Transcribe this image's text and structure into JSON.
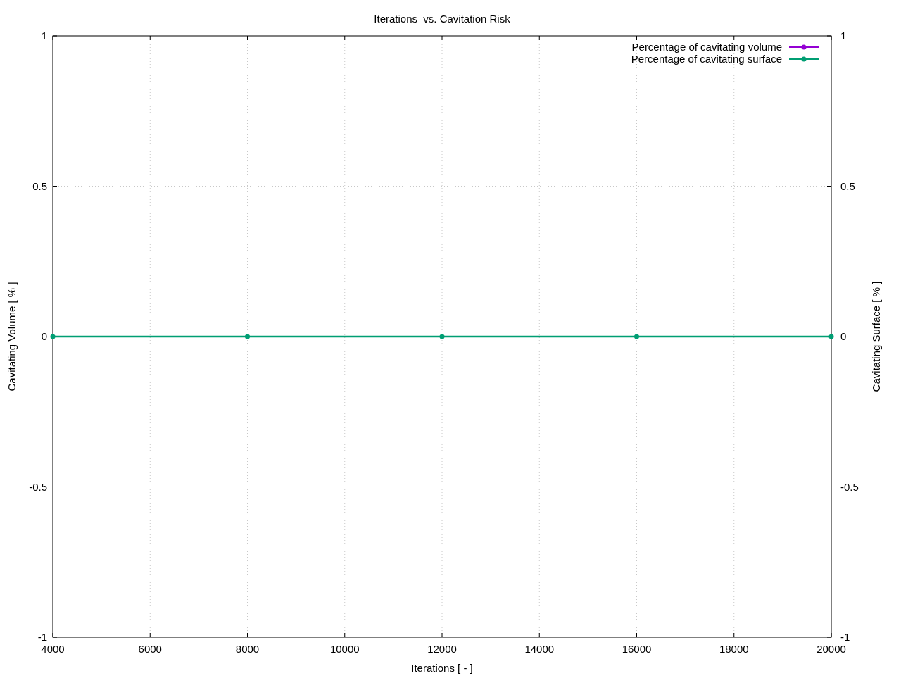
{
  "chart": {
    "chart_data": {
      "type": "line",
      "title": "Iterations  vs. Cavitation Risk",
      "xlabel": "Iterations [ - ]",
      "ylabel": "Cavitating Volume [ % ]",
      "y2label": "Cavitating Surface [ % ]",
      "x": [
        4000,
        8000,
        12000,
        16000,
        20000
      ],
      "series": [
        {
          "name": "Percentage of cavitating volume",
          "color": "#9400d3",
          "marker": "circle",
          "values": [
            null,
            null,
            null,
            null,
            null
          ]
        },
        {
          "name": "Percentage of cavitating surface",
          "color": "#009e73",
          "marker": "circle",
          "values": [
            0,
            0,
            0,
            0,
            0
          ]
        }
      ],
      "grid": true,
      "legend": true,
      "y2lim": [
        -1,
        1
      ],
      "xlim": [
        4000,
        20000
      ],
      "ylim": [
        -1,
        1
      ],
      "xticks": [
        4000,
        6000,
        8000,
        10000,
        12000,
        14000,
        16000,
        18000,
        20000
      ],
      "yticks": [
        -1,
        {
          "value": -0.5,
          "label": "-0.5"
        },
        0,
        {
          "value": 0.5,
          "label": "0.5"
        },
        1
      ],
      "y2ticks": [
        -1,
        {
          "value": -0.5,
          "label": "-0.5"
        },
        0,
        {
          "value": 0.5,
          "label": "0.5"
        },
        1
      ]
    }
  }
}
